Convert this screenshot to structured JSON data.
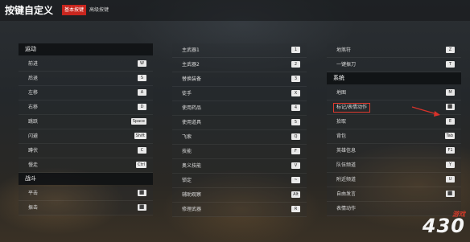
{
  "header": {
    "title": "按键自定义",
    "tabs": [
      {
        "label": "基本按键",
        "active": true
      },
      {
        "label": "高级按键",
        "active": false
      }
    ]
  },
  "columns": [
    [
      {
        "type": "section",
        "label": "运动"
      },
      {
        "type": "row",
        "label": "前进",
        "key": "W"
      },
      {
        "type": "row",
        "label": "后退",
        "key": "S"
      },
      {
        "type": "row",
        "label": "左移",
        "key": "A"
      },
      {
        "type": "row",
        "label": "右移",
        "key": "D"
      },
      {
        "type": "row",
        "label": "跳跃",
        "key": "Space"
      },
      {
        "type": "row",
        "label": "闪避",
        "key": "Shift"
      },
      {
        "type": "row",
        "label": "蹲伏",
        "key": "C"
      },
      {
        "type": "row",
        "label": "慢走",
        "key": "Ctrl"
      },
      {
        "type": "section",
        "label": "战斗"
      },
      {
        "type": "row",
        "label": "平击",
        "key": "⬛"
      },
      {
        "type": "row",
        "label": "振击",
        "key": "⬛"
      }
    ],
    [
      {
        "type": "row",
        "label": "主武器1",
        "key": "1"
      },
      {
        "type": "row",
        "label": "主武器2",
        "key": "2"
      },
      {
        "type": "row",
        "label": "替换装备",
        "key": "3"
      },
      {
        "type": "row",
        "label": "徒手",
        "key": "X"
      },
      {
        "type": "row",
        "label": "使用药品",
        "key": "4"
      },
      {
        "type": "row",
        "label": "使用道具",
        "key": "5"
      },
      {
        "type": "row",
        "label": "飞索",
        "key": "Q"
      },
      {
        "type": "row",
        "label": "技能",
        "key": "F"
      },
      {
        "type": "row",
        "label": "奥义技能",
        "key": "V"
      },
      {
        "type": "row",
        "label": "锁定",
        "key": "~"
      },
      {
        "type": "row",
        "label": "辅助观察",
        "key": "Alt"
      },
      {
        "type": "row",
        "label": "修理武器",
        "key": "R"
      }
    ],
    [
      {
        "type": "row",
        "label": "地煞符",
        "key": "Z"
      },
      {
        "type": "row",
        "label": "一键振刀",
        "key": "T"
      },
      {
        "type": "section",
        "label": "系统"
      },
      {
        "type": "row",
        "label": "地图",
        "key": "M"
      },
      {
        "type": "row",
        "label": "标记/表情动作",
        "key": "⬛",
        "highlight": true
      },
      {
        "type": "row",
        "label": "拾取",
        "key": "E"
      },
      {
        "type": "row",
        "label": "背包",
        "key": "Tab"
      },
      {
        "type": "row",
        "label": "英雄信息",
        "key": "F1"
      },
      {
        "type": "row",
        "label": "队伍频道",
        "key": "Y"
      },
      {
        "type": "row",
        "label": "附近频道",
        "key": "U"
      },
      {
        "type": "row",
        "label": "自由发言",
        "key": "⬛"
      },
      {
        "type": "row",
        "label": "表情动作",
        "key": ""
      }
    ]
  ],
  "watermark": {
    "text": "430",
    "suffix": "游戏"
  },
  "colors": {
    "accent": "#c8261e",
    "highlight": "#e03a2e"
  }
}
